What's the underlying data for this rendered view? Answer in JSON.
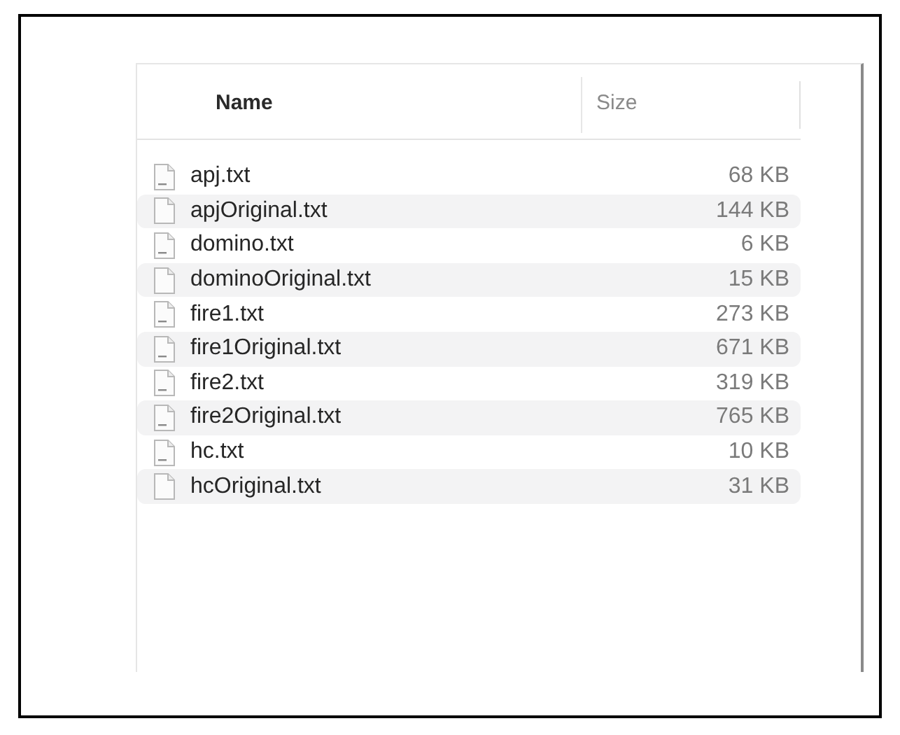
{
  "columns": [
    "Name",
    "Size"
  ],
  "rows": [
    {
      "name": "apj.txt",
      "size": "68 KB",
      "kind": "labeled"
    },
    {
      "name": "apjOriginal.txt",
      "size": "144 KB",
      "kind": "plain"
    },
    {
      "name": "domino.txt",
      "size": "6 KB",
      "kind": "labeled"
    },
    {
      "name": "dominoOriginal.txt",
      "size": "15 KB",
      "kind": "plain"
    },
    {
      "name": "fire1.txt",
      "size": "273 KB",
      "kind": "labeled"
    },
    {
      "name": "fire1Original.txt",
      "size": "671 KB",
      "kind": "labeled"
    },
    {
      "name": "fire2.txt",
      "size": "319 KB",
      "kind": "labeled"
    },
    {
      "name": "fire2Original.txt",
      "size": "765 KB",
      "kind": "labeled"
    },
    {
      "name": "hc.txt",
      "size": "10 KB",
      "kind": "labeled"
    },
    {
      "name": "hcOriginal.txt",
      "size": "31 KB",
      "kind": "plain"
    }
  ]
}
